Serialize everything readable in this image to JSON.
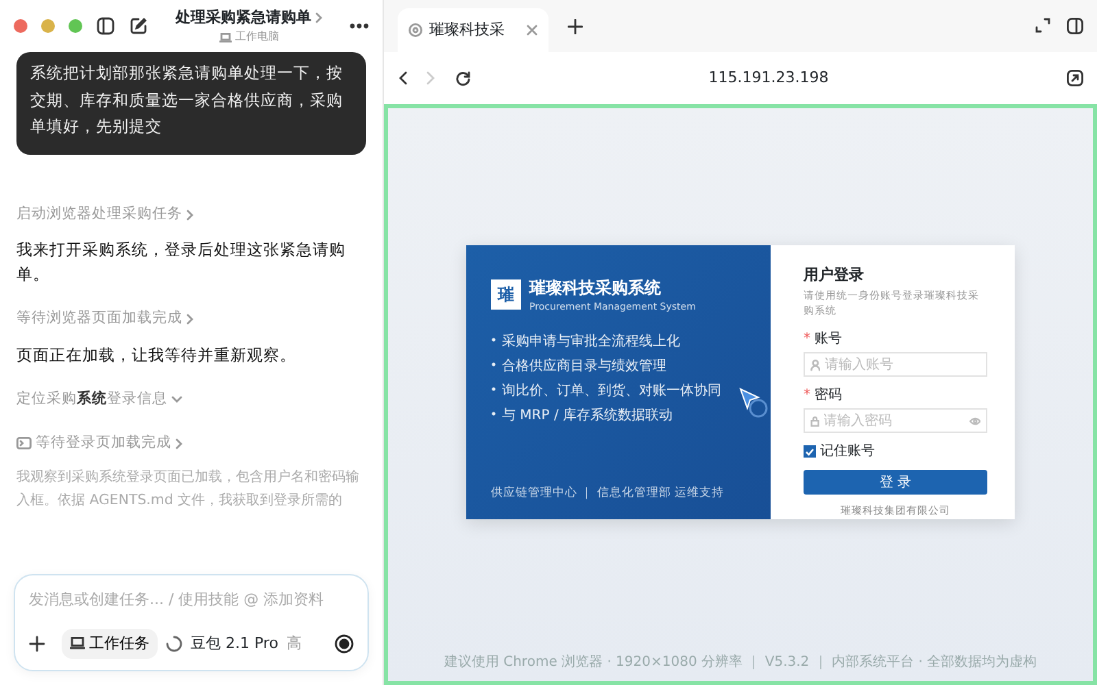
{
  "window": {
    "title": "处理采购紧急请购单",
    "subtitle": "工作电脑"
  },
  "chat": {
    "user_message": "系统把计划部那张紧急请购单处理一下，按交期、库存和质量选一家合格供应商，采购单填好，先别提交",
    "steps": [
      {
        "kind": "step",
        "text": "启动浏览器处理采购任务",
        "expanded": false
      },
      {
        "kind": "reply",
        "text": "我来打开采购系统，登录后处理这张紧急请购单。"
      },
      {
        "kind": "step",
        "text": "等待浏览器页面加载完成",
        "expanded": false
      },
      {
        "kind": "reply",
        "text": "页面正在加载，让我等待并重新观察。"
      },
      {
        "kind": "step",
        "text": "定位采购**系统**登录信息",
        "expanded": true
      },
      {
        "kind": "tool",
        "text": "等待登录页加载完成",
        "expanded": false
      },
      {
        "kind": "note",
        "text": "我观察到采购系统登录页面已加载，包含用户名和密码输入框。依据 AGENTS.md 文件，我获取到登录所需的"
      }
    ]
  },
  "composer": {
    "placeholder": "发消息或创建任务... / 使用技能 @ 添加资料",
    "task_chip": "工作任务",
    "model": "豆包 2.1 Pro",
    "effort": "高"
  },
  "browser": {
    "tab": {
      "title": "璀璨科技采",
      "selected": true
    },
    "url": "115.191.23.198",
    "login_page": {
      "logo": "璀",
      "title": "璀璨科技采购系统",
      "subtitle": "Procurement Management System",
      "features": [
        "采购申请与审批全流程线上化",
        "合格供应商目录与绩效管理",
        "询比价、订单、到货、对账一体协同",
        "与 MRP / 库存系统数据联动"
      ],
      "footer_left": "供应链管理中心 ｜ 信息化管理部 运维支持",
      "form_title": "用户登录",
      "form_hint": "请使用统一身份账号登录璀璨科技采购系统",
      "required_mark": "*",
      "account_label": "账号",
      "account_placeholder": "请输入账号",
      "password_label": "密码",
      "password_placeholder": "请输入密码",
      "remember": {
        "label": "记住账号",
        "checked": true
      },
      "submit": "登 录",
      "company": "璀璨科技集团有限公司",
      "page_footer": "建议使用 Chrome 浏览器 · 1920×1080 分辨率 ｜ V5.3.2 ｜ 内部系统平台 · 全部数据均为虚构"
    }
  }
}
